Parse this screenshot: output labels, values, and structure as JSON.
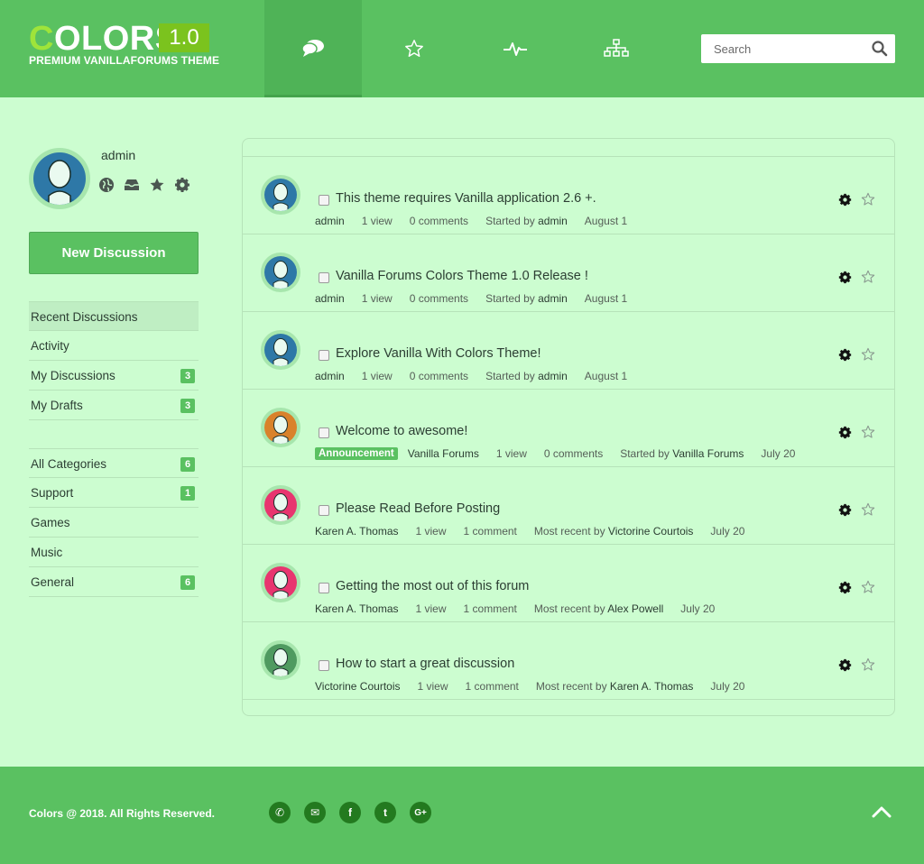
{
  "header": {
    "logo": {
      "first_letter": "C",
      "rest": "OLORS",
      "version": "1.0",
      "tagline": "PREMIUM VANILLAFORUMS THEME"
    },
    "nav_tabs": [
      {
        "name": "discussions",
        "icon": "speech-bubbles-icon",
        "active": true
      },
      {
        "name": "bookmarks",
        "icon": "star-outline-icon",
        "active": false
      },
      {
        "name": "activity",
        "icon": "pulse-icon",
        "active": false
      },
      {
        "name": "categories",
        "icon": "sitemap-icon",
        "active": false
      }
    ],
    "search": {
      "placeholder": "Search",
      "value": "",
      "icon": "search-icon"
    }
  },
  "profile": {
    "name": "admin",
    "icons": [
      "globe-icon",
      "inbox-icon",
      "star-icon",
      "gear-icon"
    ]
  },
  "new_discussion_label": "New Discussion",
  "nav_menu": [
    {
      "label": "Recent Discussions",
      "count": "",
      "active": true
    },
    {
      "label": "Activity",
      "count": ""
    },
    {
      "label": "My Discussions",
      "count": "3"
    },
    {
      "label": "My Drafts",
      "count": "3"
    }
  ],
  "categories_menu": [
    {
      "label": "All Categories",
      "count": "6"
    },
    {
      "label": "Support",
      "count": "1"
    },
    {
      "label": "Games",
      "count": ""
    },
    {
      "label": "Music",
      "count": ""
    },
    {
      "label": "General",
      "count": "6"
    }
  ],
  "discussions": [
    {
      "title": "This theme requires Vanilla application 2.6 +.",
      "tag": "",
      "author": "admin",
      "views": "1 view",
      "comments": "0 comments",
      "last_label": "Started by",
      "last_user": "admin",
      "date": "August 1",
      "avatar_color": "#2e78a7",
      "avatar_shirt": "#2f9bd3"
    },
    {
      "title": "Vanilla Forums Colors Theme 1.0 Release !",
      "tag": "",
      "author": "admin",
      "views": "1 view",
      "comments": "0 comments",
      "last_label": "Started by",
      "last_user": "admin",
      "date": "August 1",
      "avatar_color": "#2e78a7",
      "avatar_shirt": "#2f9bd3"
    },
    {
      "title": "Explore Vanilla With Colors Theme!",
      "tag": "",
      "author": "admin",
      "views": "1 view",
      "comments": "0 comments",
      "last_label": "Started by",
      "last_user": "admin",
      "date": "August 1",
      "avatar_color": "#2e78a7",
      "avatar_shirt": "#2f9bd3"
    },
    {
      "title": "Welcome to awesome!",
      "tag": "Announcement",
      "author": "Vanilla Forums",
      "views": "1 view",
      "comments": "0 comments",
      "last_label": "Started by",
      "last_user": "Vanilla Forums",
      "date": "July 20",
      "avatar_color": "#d9822b",
      "avatar_shirt": "#2f9bd3"
    },
    {
      "title": "Please Read Before Posting",
      "tag": "",
      "author": "Karen A. Thomas",
      "views": "1 view",
      "comments": "1 comment",
      "last_label": "Most recent by",
      "last_user": "Victorine Courtois",
      "date": "July 20",
      "avatar_color": "#e8356f",
      "avatar_shirt": "#f4a3bd"
    },
    {
      "title": "Getting the most out of this forum",
      "tag": "",
      "author": "Karen A. Thomas",
      "views": "1 view",
      "comments": "1 comment",
      "last_label": "Most recent by",
      "last_user": "Alex Powell",
      "date": "July 20",
      "avatar_color": "#e8356f",
      "avatar_shirt": "#f4a3bd"
    },
    {
      "title": "How to start a great discussion",
      "tag": "",
      "author": "Victorine Courtois",
      "views": "1 view",
      "comments": "1 comment",
      "last_label": "Most recent by",
      "last_user": "Karen A. Thomas",
      "date": "July 20",
      "avatar_color": "#4f9a60",
      "avatar_shirt": "#2e7a40"
    }
  ],
  "footer": {
    "copyright": "Colors @ 2018. All Rights Reserved.",
    "socials": [
      {
        "icon": "phone-icon",
        "glyph": "✆"
      },
      {
        "icon": "mail-icon",
        "glyph": "✉"
      },
      {
        "icon": "facebook-icon",
        "glyph": "f"
      },
      {
        "icon": "twitter-icon",
        "glyph": "t"
      },
      {
        "icon": "google-plus-icon",
        "glyph": "G+"
      }
    ],
    "back_to_top_icon": "chevron-up-icon"
  },
  "colors": {
    "header": "#5ac161",
    "background": "#ccfdd0",
    "accent": "#5ac161",
    "logo_version_bg": "#7bc31e",
    "social_bg": "#237a1f"
  }
}
